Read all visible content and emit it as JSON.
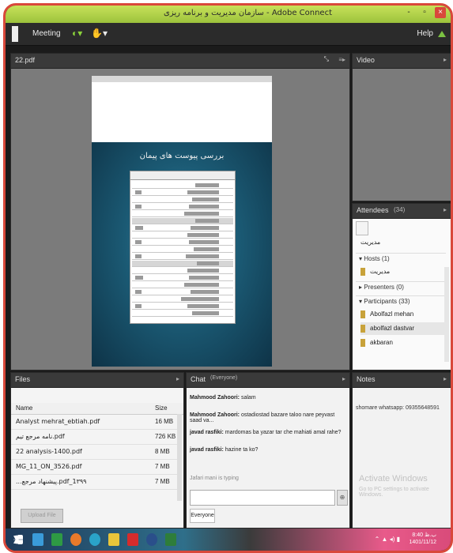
{
  "window": {
    "title": "سازمان مدیریت و برنامه ریزی - Adobe Connect",
    "minimize": "-",
    "maximize": "▫",
    "close": "×"
  },
  "menubar": {
    "meeting": "Meeting",
    "help": "Help"
  },
  "share_pod": {
    "title": "22.pdf",
    "slide_title": "بررسی پیوست های پیمان"
  },
  "video_pod": {
    "title": "Video"
  },
  "attendees_pod": {
    "title": "Attendees",
    "count": "(34)",
    "role_label": "مدیریت",
    "groups": [
      {
        "label": "▾ Hosts (1)"
      },
      {
        "label": "▸ Presenters (0)"
      },
      {
        "label": "▾ Participants (33)"
      }
    ],
    "hosts": [
      {
        "name": "مدیریت"
      }
    ],
    "participants": [
      {
        "name": "Abolfazl mehan"
      },
      {
        "name": "abolfazl dastvar"
      },
      {
        "name": "akbaran"
      }
    ]
  },
  "files_pod": {
    "title": "Files",
    "col_name": "Name",
    "col_size": "Size",
    "rows": [
      {
        "name": "Analyst mehrat_ebtiah.pdf",
        "size": "16 MB"
      },
      {
        "name": "نامه مرجع تیم.pdf",
        "size": "726 KB"
      },
      {
        "name": "22 analysis-1400.pdf",
        "size": "8 MB"
      },
      {
        "name": "MG_11_ON_3526.pdf",
        "size": "7 MB"
      },
      {
        "name": "...پیشنهاد مرجع.pdf_1۳۹۹",
        "size": "7 MB"
      }
    ],
    "upload": "Upload File"
  },
  "chat_pod": {
    "title": "Chat",
    "recipient": "(Everyone)",
    "messages": [
      {
        "sender": "Mahmood Zahoori:",
        "text": "salam"
      },
      {
        "sender": "Mahmood Zahoori:",
        "text": "ostadiostad bazare taloo nare peyvast saad va..."
      },
      {
        "sender": "javad rasfiki:",
        "text": "mardomas ba yazar tar che mahiati amal rahe?"
      },
      {
        "sender": "javad rasfiki:",
        "text": "hazine ta ko?"
      }
    ],
    "typing": "Jafari mani is typing",
    "send": "⊕",
    "tab": "Everyone"
  },
  "notes_pod": {
    "title": "Notes",
    "text": "shomare whatsapp: 09355648591",
    "watermark_line1": "Activate Windows",
    "watermark_line2": "Go to PC settings to activate Windows."
  },
  "taskbar": {
    "time": "8:40 ب.ظ",
    "date": "1401/11/12",
    "tray": "⌃ ▲ ◂) ▮"
  },
  "colors": {
    "frame_border": "#d9483b",
    "titlebar": "#b8d64a",
    "slide_bg": "#124a62"
  }
}
